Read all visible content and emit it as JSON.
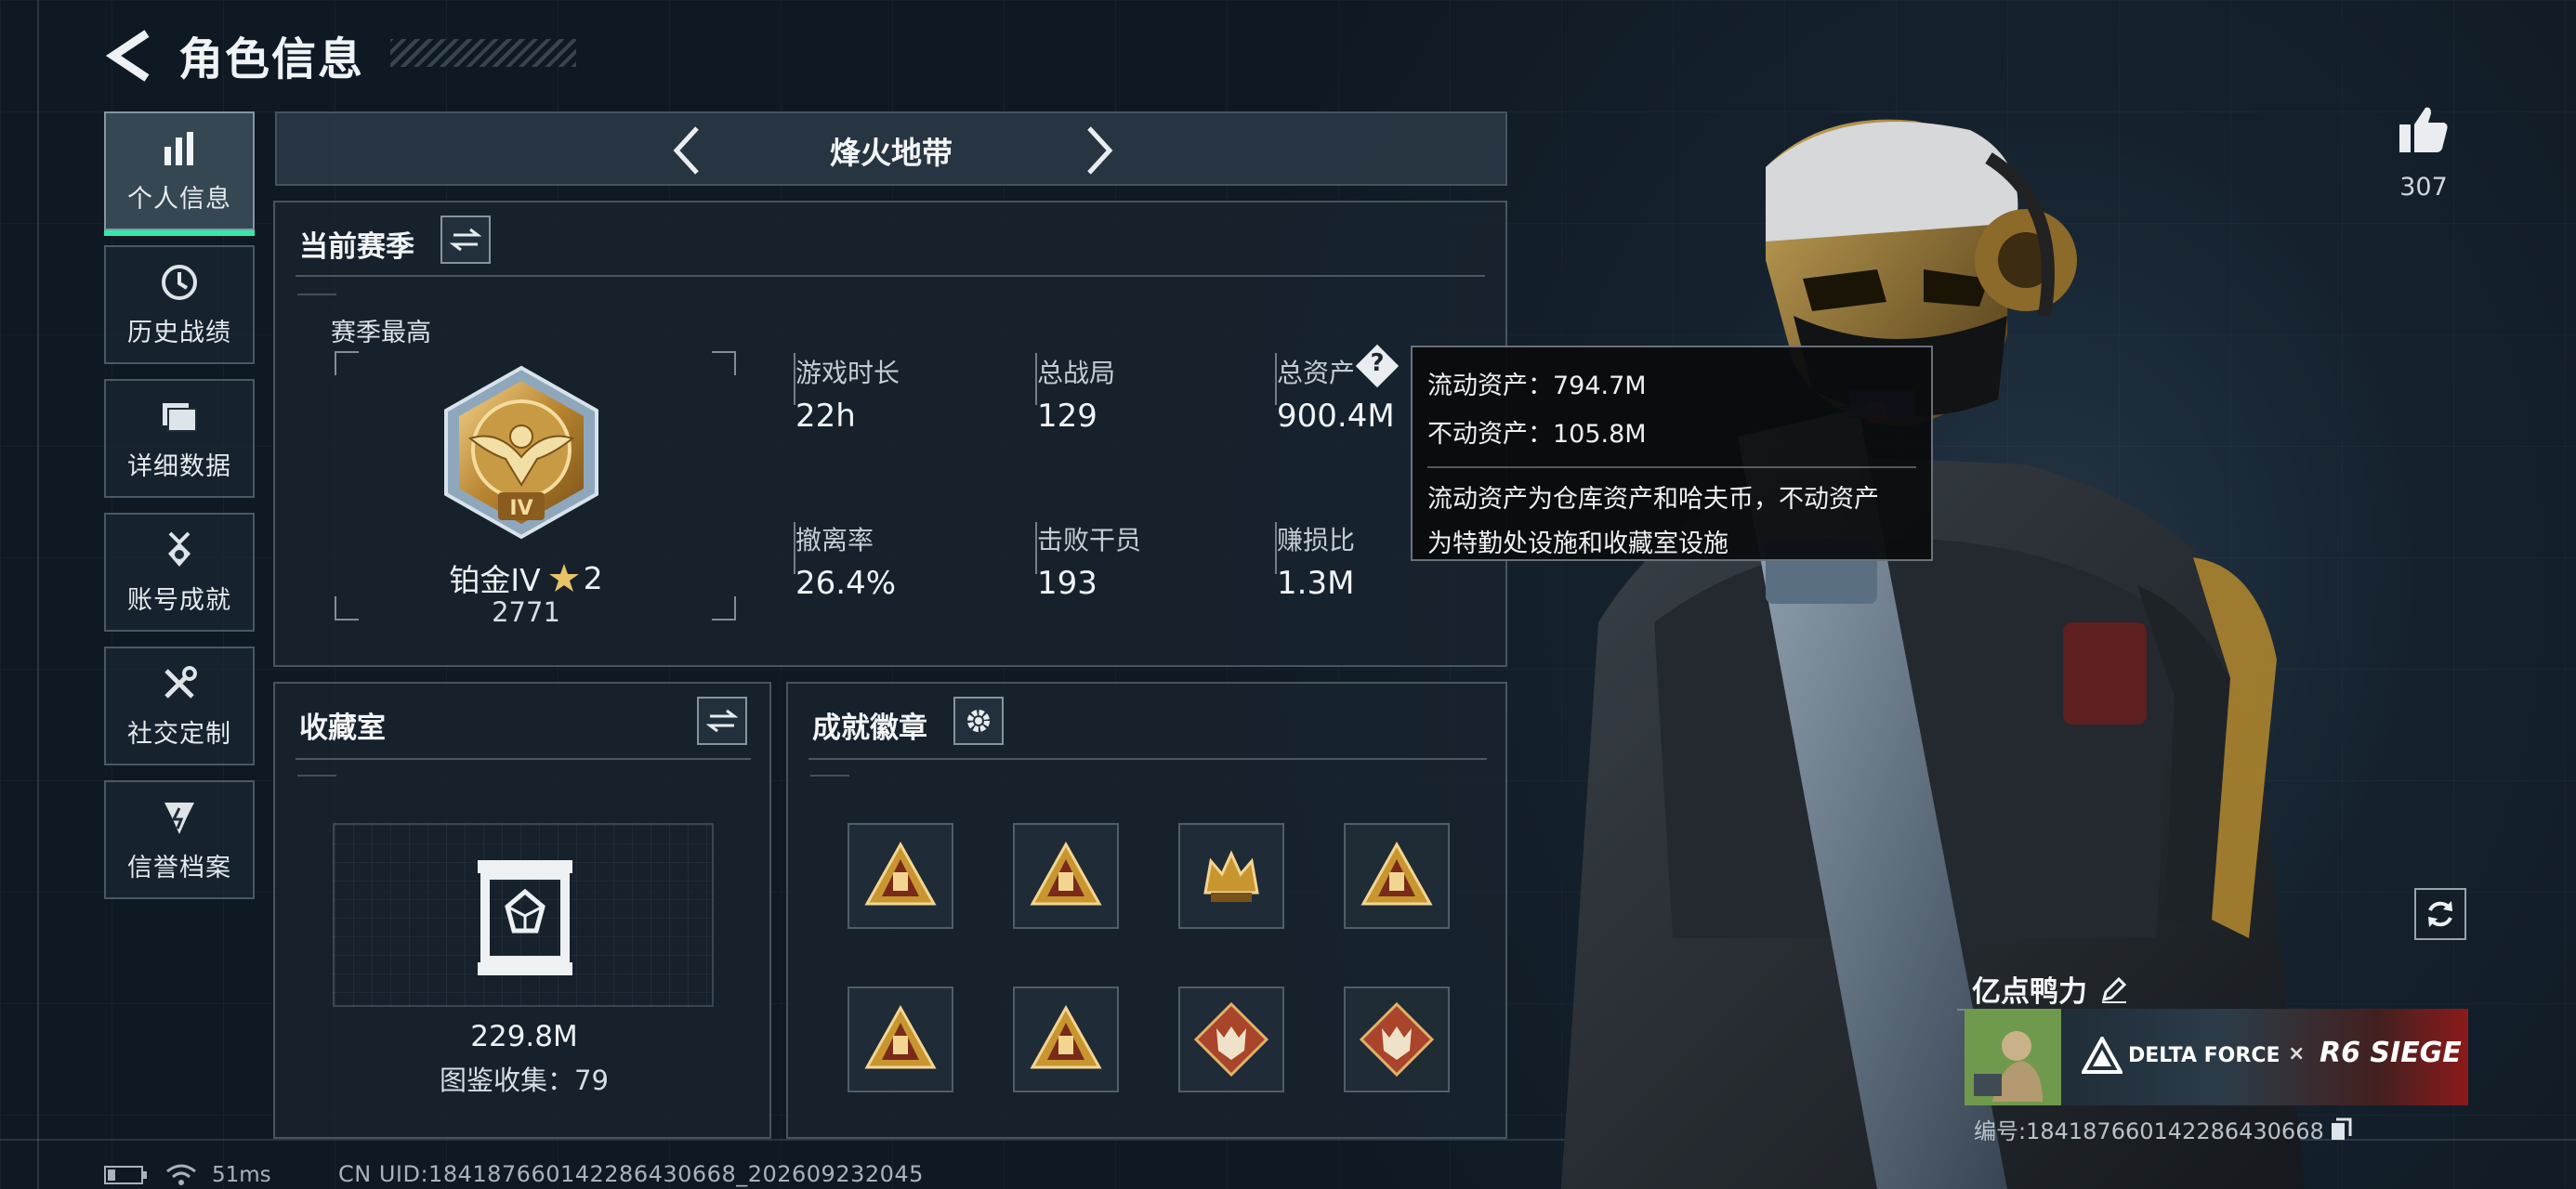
{
  "header": {
    "title": "角色信息"
  },
  "nav": {
    "items": [
      {
        "label": "个人信息",
        "icon": "bar-chart-icon",
        "active": true
      },
      {
        "label": "历史战绩",
        "icon": "clock-icon",
        "active": false
      },
      {
        "label": "详细数据",
        "icon": "folder-icon",
        "active": false
      },
      {
        "label": "账号成就",
        "icon": "medal-icon",
        "active": false
      },
      {
        "label": "社交定制",
        "icon": "tools-icon",
        "active": false
      },
      {
        "label": "信誉档案",
        "icon": "shield-icon",
        "active": false
      }
    ]
  },
  "mode": {
    "label": "烽火地带"
  },
  "season": {
    "title": "当前赛季",
    "best_label": "赛季最高",
    "rank_name": "铂金IV",
    "rank_stars": "2",
    "rank_points": "2771",
    "rank_emblem_text": "IV",
    "stats": [
      {
        "label": "游戏时长",
        "value": "22h"
      },
      {
        "label": "总战局",
        "value": "129"
      },
      {
        "label": "总资产",
        "value": "900.4M"
      },
      {
        "label": "撤离率",
        "value": "26.4%"
      },
      {
        "label": "击败干员",
        "value": "193"
      },
      {
        "label": "赚损比",
        "value": "1.3M"
      }
    ]
  },
  "tooltip": {
    "liquid": "流动资产：794.7M",
    "fixed": "不动资产：105.8M",
    "desc_1": "流动资产为仓库资产和哈夫币，不动资产",
    "desc_2": "为特勤处设施和收藏室设施"
  },
  "collection": {
    "title": "收藏室",
    "value": "229.8M",
    "catalog": "图鉴收集：79"
  },
  "badges": {
    "title": "成就徽章",
    "items": [
      {
        "icon": "triangle-badge-icon",
        "accent": "#c8962f"
      },
      {
        "icon": "triangle-badge-icon",
        "accent": "#c8962f"
      },
      {
        "icon": "crown-badge-icon",
        "accent": "#c8962f"
      },
      {
        "icon": "triangle-badge-icon",
        "accent": "#c8962f"
      },
      {
        "icon": "triangle-badge-icon",
        "accent": "#c8962f"
      },
      {
        "icon": "triangle-badge-icon",
        "accent": "#c8962f"
      },
      {
        "icon": "wolf-badge-icon",
        "accent": "#a8452a"
      },
      {
        "icon": "wolf-badge-icon",
        "accent": "#a8452a"
      }
    ]
  },
  "profile": {
    "likes": "307",
    "name": "亿点鸭力",
    "banner_brand_1": "DELTA FORCE",
    "banner_x": "×",
    "banner_brand_2": "R6 SIEGE",
    "serial": "编号:18418766014228643066​8"
  },
  "status": {
    "ping": "51ms",
    "uid": "CN UID:18418766014228643066​8_202609232045"
  },
  "colors": {
    "accent_green": "#36e8a8",
    "gold": "#c8962f"
  }
}
